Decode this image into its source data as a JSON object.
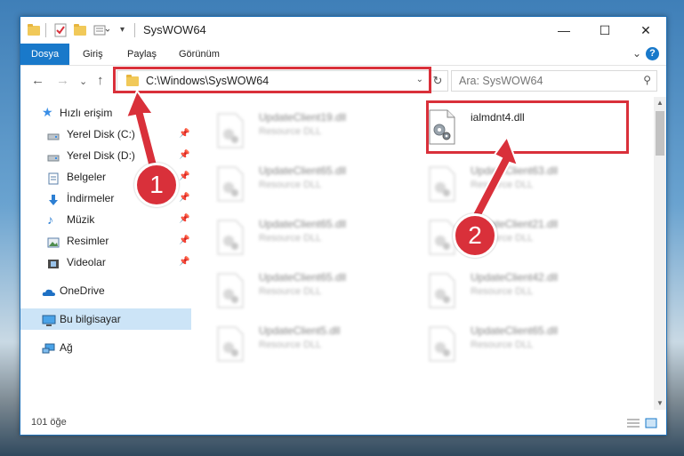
{
  "window": {
    "title": "SysWOW64",
    "controls": {
      "minimize": "—",
      "maximize": "☐",
      "close": "✕"
    }
  },
  "ribbon": {
    "tabs": [
      {
        "label": "Dosya",
        "active": true
      },
      {
        "label": "Giriş",
        "active": false
      },
      {
        "label": "Paylaş",
        "active": false
      },
      {
        "label": "Görünüm",
        "active": false
      }
    ],
    "help": "?"
  },
  "nav": {
    "back": "←",
    "forward": "→",
    "recent": "⌄",
    "up": "↑",
    "address": "C:\\Windows\\SysWOW64",
    "refresh": "↻",
    "search_placeholder": "Ara: SysWOW64"
  },
  "sidebar": {
    "items": [
      {
        "label": "Hızlı erişim",
        "icon": "star-icon",
        "pinned": false
      },
      {
        "label": "Yerel Disk (C:)",
        "icon": "drive-icon",
        "pinned": true
      },
      {
        "label": "Yerel Disk (D:)",
        "icon": "drive-icon",
        "pinned": true
      },
      {
        "label": "Belgeler",
        "icon": "documents-icon",
        "pinned": true
      },
      {
        "label": "İndirmeler",
        "icon": "download-icon",
        "pinned": true
      },
      {
        "label": "Müzik",
        "icon": "music-icon",
        "pinned": true
      },
      {
        "label": "Resimler",
        "icon": "pictures-icon",
        "pinned": true
      },
      {
        "label": "Videolar",
        "icon": "videos-icon",
        "pinned": true
      },
      {
        "label": "OneDrive",
        "icon": "cloud-icon",
        "pinned": false
      },
      {
        "label": "Bu bilgisayar",
        "icon": "computer-icon",
        "pinned": false
      },
      {
        "label": "Ağ",
        "icon": "network-icon",
        "pinned": false
      }
    ]
  },
  "files": [
    {
      "name": "UpdateClient19.dll",
      "type": "Resource DLL",
      "blurred": true
    },
    {
      "name": "ialmdnt4.dll",
      "type": "",
      "blurred": false
    },
    {
      "name": "UpdateClient65.dll",
      "type": "Resource DLL",
      "blurred": true
    },
    {
      "name": "UpdateClient63.dll",
      "type": "Resource DLL",
      "blurred": true
    },
    {
      "name": "UpdateClient65.dll",
      "type": "Resource DLL",
      "blurred": true
    },
    {
      "name": "UpdateClient21.dll",
      "type": "Resource DLL",
      "blurred": true
    },
    {
      "name": "UpdateClient65.dll",
      "type": "Resource DLL",
      "blurred": true
    },
    {
      "name": "UpdateClient42.dll",
      "type": "Resource DLL",
      "blurred": true
    },
    {
      "name": "UpdateClient5.dll",
      "type": "Resource DLL",
      "blurred": true
    },
    {
      "name": "UpdateClient65.dll",
      "type": "Resource DLL",
      "blurred": true
    }
  ],
  "status": {
    "count": "101 öğe"
  },
  "annotations": [
    {
      "number": "1"
    },
    {
      "number": "2"
    }
  ],
  "colors": {
    "accent": "#1979ca",
    "highlight": "#d9303a",
    "selected": "#cce4f7"
  }
}
